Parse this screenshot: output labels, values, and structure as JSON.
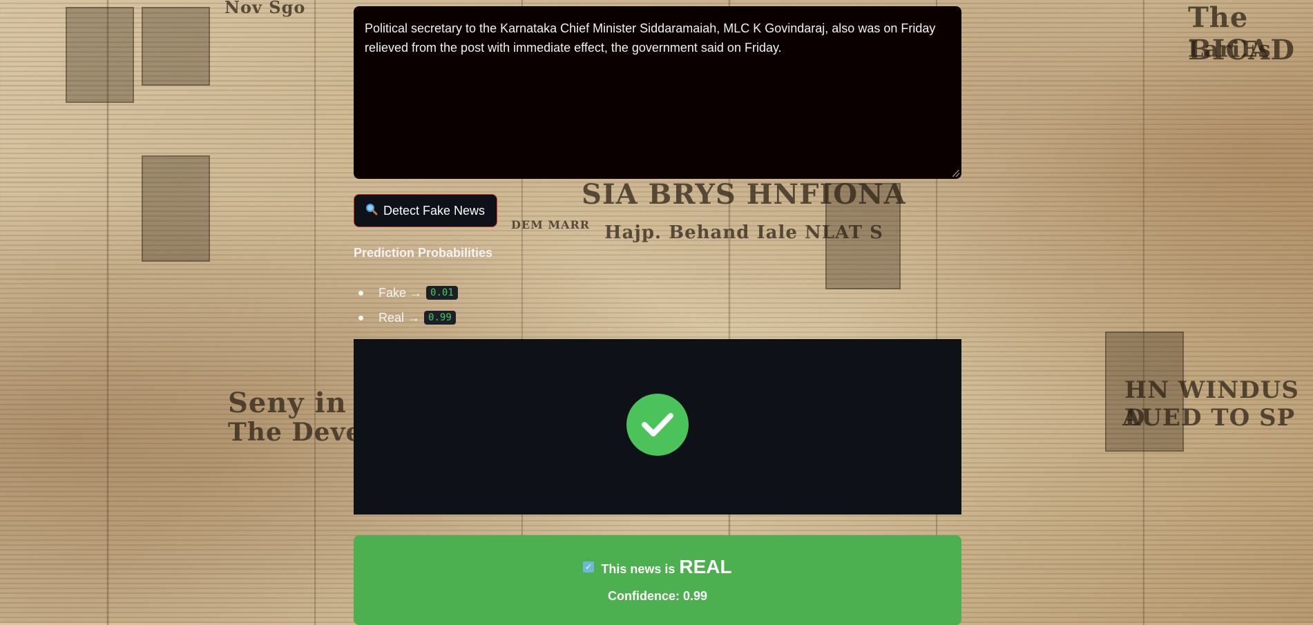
{
  "input": {
    "text": "Political secretary to the Karnataka Chief Minister Siddaramaiah, MLC K Govindaraj, also was on Friday relieved from the post with immediate effect, the government said on Friday."
  },
  "actions": {
    "detect_label": "Detect Fake News",
    "detect_icon": "magnifier-icon"
  },
  "probabilities": {
    "title": "Prediction Probabilities",
    "items": [
      {
        "label": "Fake",
        "arrow": "→",
        "value": "0.01"
      },
      {
        "label": "Real",
        "arrow": "→",
        "value": "0.99"
      }
    ]
  },
  "result": {
    "icon": "check-circle-icon",
    "verdict_prefix": "This news is",
    "verdict": "REAL",
    "confidence_text": "Confidence: 0.99",
    "colors": {
      "success": "#4caf50",
      "check": "#4cc35a",
      "panel": "#0e1117"
    }
  },
  "background": {
    "headlines": [
      "The BICAD",
      "LariEs",
      "SIA BRYS HNFIONA",
      "Hajp. Behand Iale NLAT S",
      "Seny in the",
      "The Deveren",
      "HN WINDUS D",
      "AUED TO SP",
      "Nov Sgo",
      "DEM MARR"
    ]
  }
}
